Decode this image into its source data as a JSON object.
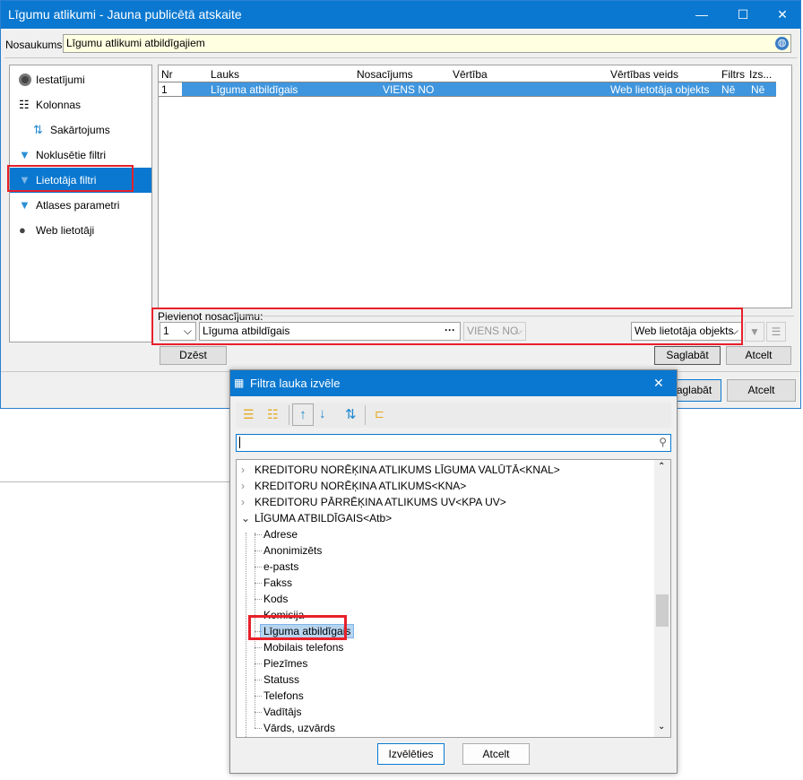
{
  "window": {
    "title": "Līgumu atlikumi - Jauna publicētā atskaite",
    "name_label": "Nosaukums:",
    "name_value": "Līgumu atlikumi atbildīgajiem"
  },
  "sidebar": {
    "items": [
      {
        "label": "Iestatījumi",
        "icon": "gear-icon"
      },
      {
        "label": "Kolonnas",
        "icon": "columns-icon"
      },
      {
        "label": "Sakārtojums",
        "icon": "sort-icon"
      },
      {
        "label": "Noklusētie filtri",
        "icon": "filter-question-icon"
      },
      {
        "label": "Lietotāja filtri",
        "icon": "user-filter-icon",
        "selected": true
      },
      {
        "label": "Atlases parametri",
        "icon": "filter-icon"
      },
      {
        "label": "Web lietotāji",
        "icon": "user-icon"
      }
    ]
  },
  "grid": {
    "columns": [
      "Nr",
      "Lauks",
      "Nosacījums",
      "Vērtība",
      "Vērtības veids",
      "Filtrs",
      "Izs..."
    ],
    "rows": [
      [
        "1",
        "Līguma atbildīgais",
        "VIENS NO",
        "",
        "Web lietotāja objekts",
        "Nē",
        "Nē"
      ]
    ]
  },
  "condition": {
    "group_label": "Pievienot nosacījumu:",
    "nr": "1",
    "field": "Līguma atbildīgais",
    "ellipsis": "···",
    "operator": "VIENS NO",
    "value_type": "Web lietotāja objekts"
  },
  "buttons": {
    "delete": "Dzēst",
    "save": "Saglabāt",
    "cancel": "Atcelt",
    "window_save": "Saglabāt",
    "window_cancel": "Atcelt"
  },
  "dialog": {
    "title": "Filtra lauka izvēle",
    "search_value": "",
    "tree": [
      {
        "label": "KREDITORU NORĒĶINA ATLIKUMS LĪGUMA VALŪTĀ<KNAL>",
        "type": "collapsed"
      },
      {
        "label": "KREDITORU NORĒĶINA ATLIKUMS<KNA>",
        "type": "collapsed"
      },
      {
        "label": "KREDITORU PĀRRĒĶINA ATLIKUMS UV<KPA UV>",
        "type": "collapsed"
      },
      {
        "label": "LĪGUMA ATBILDĪGAIS<Atb>",
        "type": "expanded"
      },
      {
        "label": "Adrese",
        "type": "leaf"
      },
      {
        "label": "Anonimizēts",
        "type": "leaf"
      },
      {
        "label": "e-pasts",
        "type": "leaf"
      },
      {
        "label": "Fakss",
        "type": "leaf"
      },
      {
        "label": "Kods",
        "type": "leaf"
      },
      {
        "label": "Komisija",
        "type": "leaf"
      },
      {
        "label": "Līguma atbildīgais",
        "type": "leaf",
        "selected": true
      },
      {
        "label": "Mobilais telefons",
        "type": "leaf"
      },
      {
        "label": "Piezīmes",
        "type": "leaf"
      },
      {
        "label": "Statuss",
        "type": "leaf"
      },
      {
        "label": "Telefons",
        "type": "leaf"
      },
      {
        "label": "Vadītājs",
        "type": "leaf"
      },
      {
        "label": "Vārds, uzvārds",
        "type": "leaf"
      }
    ],
    "choose": "Izvēlēties",
    "cancel": "Atcelt"
  },
  "colors": {
    "accent": "#0a78d0",
    "selection": "#3f96de",
    "highlight": "#e8202a"
  }
}
